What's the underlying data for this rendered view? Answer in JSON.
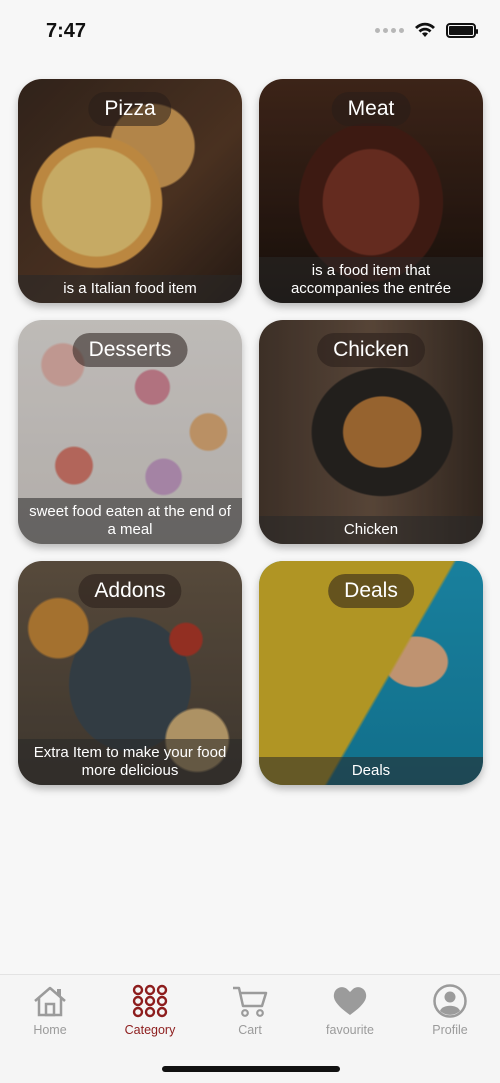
{
  "status_bar": {
    "time": "7:47"
  },
  "categories": [
    {
      "title": "Pizza",
      "description": "is a Italian food item"
    },
    {
      "title": "Meat",
      "description": "is a food item that accompanies the entrée"
    },
    {
      "title": "Desserts",
      "description": "sweet food eaten at the end of a meal"
    },
    {
      "title": "Chicken",
      "description": "Chicken"
    },
    {
      "title": "Addons",
      "description": "Extra Item to make your food more delicious"
    },
    {
      "title": "Deals",
      "description": "Deals"
    }
  ],
  "tab_bar": {
    "items": [
      {
        "label": "Home",
        "icon": "home-icon"
      },
      {
        "label": "Category",
        "icon": "grid-dots-icon",
        "active": true
      },
      {
        "label": "Cart",
        "icon": "cart-icon"
      },
      {
        "label": "favourite",
        "icon": "heart-icon"
      },
      {
        "label": "Profile",
        "icon": "profile-icon"
      }
    ]
  },
  "colors": {
    "accent": "#8d1d1d",
    "inactive": "#9b9b9b"
  }
}
